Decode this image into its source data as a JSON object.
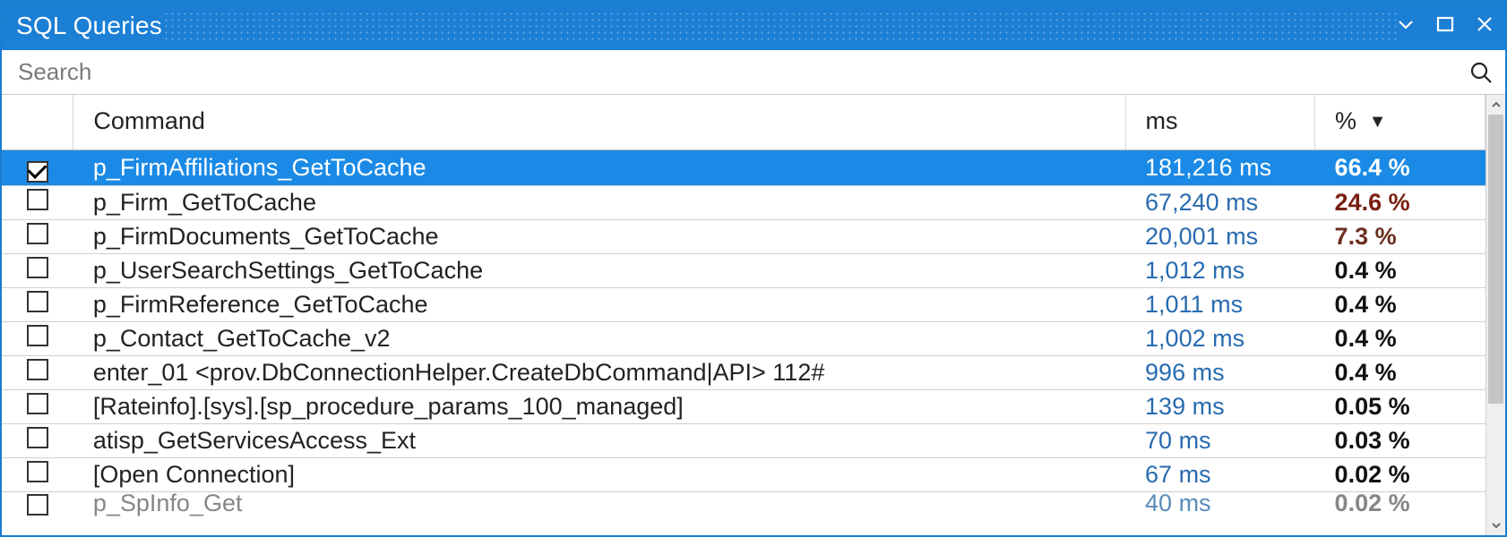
{
  "window": {
    "title": "SQL Queries"
  },
  "search": {
    "placeholder": "Search"
  },
  "columns": {
    "command": "Command",
    "ms": "ms",
    "percent": "%",
    "sort_indicator": "▼"
  },
  "rows": [
    {
      "checked": true,
      "selected": true,
      "command": "p_FirmAffiliations_GetToCache",
      "ms": "181,216 ms",
      "pct": "66.4 %",
      "pct_class": ""
    },
    {
      "checked": false,
      "selected": false,
      "command": "p_Firm_GetToCache",
      "ms": "67,240 ms",
      "pct": "24.6 %",
      "pct_class": "hot"
    },
    {
      "checked": false,
      "selected": false,
      "command": "p_FirmDocuments_GetToCache",
      "ms": "20,001 ms",
      "pct": "7.3 %",
      "pct_class": "warm"
    },
    {
      "checked": false,
      "selected": false,
      "command": "p_UserSearchSettings_GetToCache",
      "ms": "1,012 ms",
      "pct": "0.4 %",
      "pct_class": ""
    },
    {
      "checked": false,
      "selected": false,
      "command": "p_FirmReference_GetToCache",
      "ms": "1,011 ms",
      "pct": "0.4 %",
      "pct_class": ""
    },
    {
      "checked": false,
      "selected": false,
      "command": "p_Contact_GetToCache_v2",
      "ms": "1,002 ms",
      "pct": "0.4 %",
      "pct_class": ""
    },
    {
      "checked": false,
      "selected": false,
      "command": "enter_01 <prov.DbConnectionHelper.CreateDbCommand|API> 112#",
      "ms": "996 ms",
      "pct": "0.4 %",
      "pct_class": ""
    },
    {
      "checked": false,
      "selected": false,
      "command": "[Rateinfo].[sys].[sp_procedure_params_100_managed]",
      "ms": "139 ms",
      "pct": "0.05 %",
      "pct_class": ""
    },
    {
      "checked": false,
      "selected": false,
      "command": "atisp_GetServicesAccess_Ext",
      "ms": "70 ms",
      "pct": "0.03 %",
      "pct_class": ""
    },
    {
      "checked": false,
      "selected": false,
      "command": "[Open Connection]",
      "ms": "67 ms",
      "pct": "0.02 %",
      "pct_class": ""
    },
    {
      "checked": false,
      "selected": false,
      "command": "p_SpInfo_Get",
      "ms": "40 ms",
      "pct": "0.02 %",
      "pct_class": "",
      "cut": true
    }
  ]
}
